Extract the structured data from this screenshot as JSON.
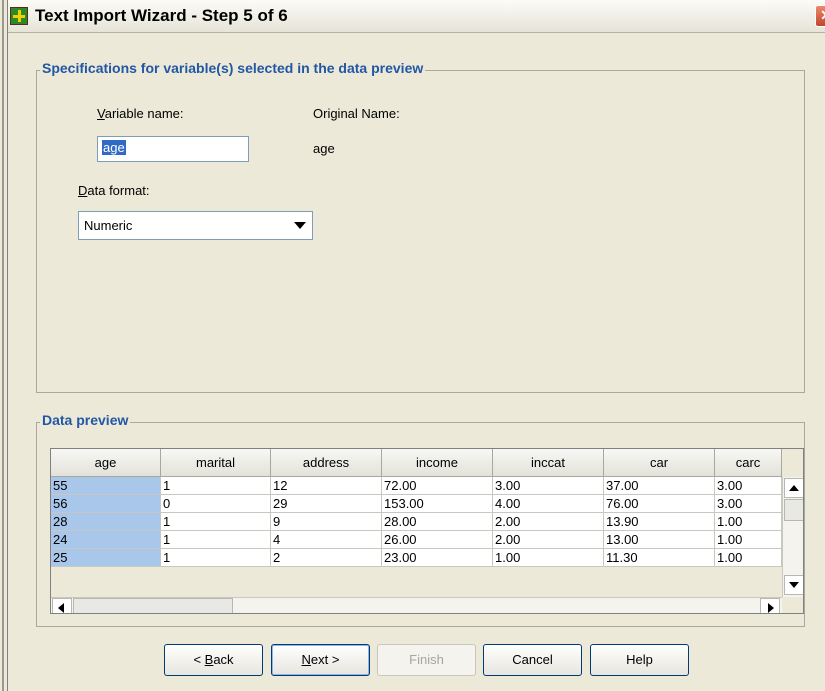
{
  "window": {
    "title": "Text Import Wizard - Step 5 of 6",
    "close_glyph": "✕"
  },
  "specs": {
    "legend": "Specifications for variable(s) selected in the data preview",
    "variable_name_label_accel": "V",
    "variable_name_label_rest": "ariable name:",
    "variable_name_value": "age",
    "original_name_label": "Original Name:",
    "original_name_value": "age",
    "data_format_label_accel": "D",
    "data_format_label_rest": "ata format:",
    "data_format_value": "Numeric"
  },
  "preview": {
    "legend": "Data preview",
    "columns": [
      "age",
      "marital",
      "address",
      "income",
      "inccat",
      "car",
      "carc"
    ],
    "rows": [
      [
        "55",
        "1",
        "12",
        "72.00",
        "3.00",
        "37.00",
        "3.00"
      ],
      [
        "56",
        "0",
        "29",
        "153.00",
        "4.00",
        "76.00",
        "3.00"
      ],
      [
        "28",
        "1",
        "9",
        "28.00",
        "2.00",
        "13.90",
        "1.00"
      ],
      [
        "24",
        "1",
        "4",
        "26.00",
        "2.00",
        "13.00",
        "1.00"
      ],
      [
        "25",
        "1",
        "2",
        "23.00",
        "1.00",
        "11.30",
        "1.00"
      ]
    ]
  },
  "buttons": {
    "back_pre": "< ",
    "back_accel": "B",
    "back_rest": "ack",
    "next_accel": "N",
    "next_rest": "ext >",
    "finish": "Finish",
    "cancel": "Cancel",
    "help": "Help"
  },
  "colors": {
    "accent": "#2257a5",
    "selected_column": "#a9c7ea",
    "dialog_bg": "#ece9d8"
  }
}
